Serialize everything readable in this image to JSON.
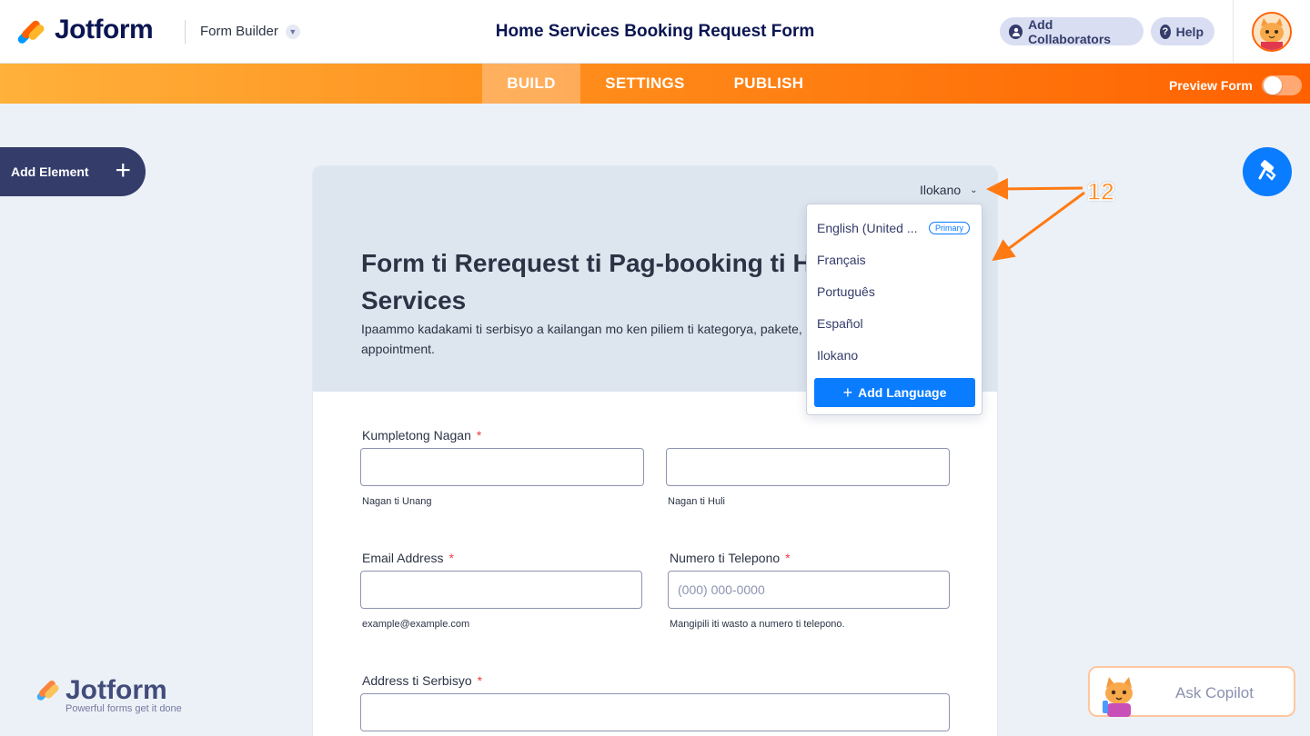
{
  "topbar": {
    "logo_text": "Jotform",
    "form_builder_label": "Form Builder",
    "form_title": "Home Services Booking Request Form",
    "add_collaborators_label": "Add Collaborators",
    "help_label": "Help"
  },
  "nav": {
    "tabs": [
      {
        "label": "BUILD",
        "active": true
      },
      {
        "label": "SETTINGS",
        "active": false
      },
      {
        "label": "PUBLISH",
        "active": false
      }
    ],
    "preview_label": "Preview Form",
    "preview_on": false
  },
  "add_element_label": "Add Element",
  "form": {
    "current_language": "Ilokano",
    "heading": "Form ti Rerequest ti Pag-booking ti H Services",
    "heading_line1": "Form ti Rerequest ti Pag-booking ti H",
    "heading_line2": "Services",
    "description_line1": "Ipaammo kadakami ti serbisyo a kailangan mo ken piliem ti kategorya, pakete,",
    "description_line2": "appointment.",
    "fields": {
      "full_name": {
        "label": "Kumpletong Nagan",
        "required": "*",
        "first_sub": "Nagan ti Unang",
        "last_sub": "Nagan ti Huli"
      },
      "email": {
        "label": "Email Address",
        "required": "*",
        "sub": "example@example.com"
      },
      "phone": {
        "label": "Numero ti Telepono",
        "required": "*",
        "placeholder": "(000) 000-0000",
        "sub": "Mangipili iti wasto a numero ti telepono."
      },
      "address": {
        "label": "Address ti Serbisyo",
        "required": "*"
      }
    }
  },
  "language_menu": {
    "items": [
      {
        "label": "English (United ...",
        "badge": "Primary"
      },
      {
        "label": "Français"
      },
      {
        "label": "Português"
      },
      {
        "label": "Español"
      },
      {
        "label": "Ilokano"
      }
    ],
    "add_language_label": "Add Language"
  },
  "annotation": {
    "number": "12",
    "color": "#ff8a1f"
  },
  "watermark": {
    "word": "Jotform",
    "tagline": "Powerful forms get it done"
  },
  "copilot": {
    "label": "Ask Copilot"
  },
  "colors": {
    "brand_navy": "#0a1551",
    "accent_blue": "#0a7cff",
    "accent_orange": "#ff6100"
  }
}
